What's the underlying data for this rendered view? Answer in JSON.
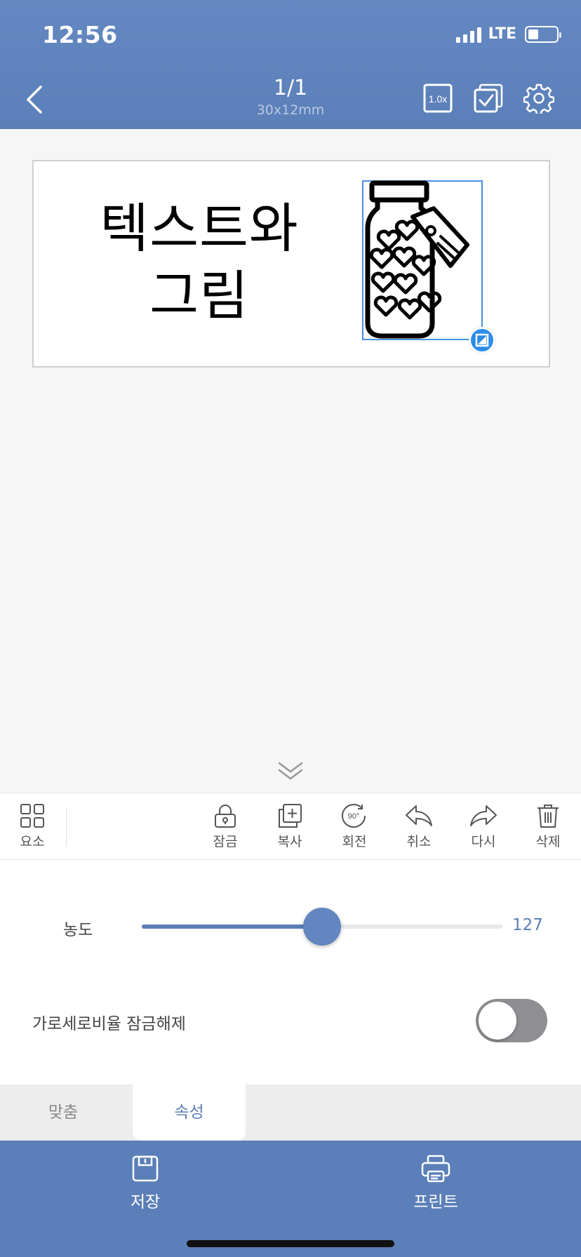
{
  "status_bar": {
    "time": "12:56",
    "network": "LTE",
    "signal_icon": "signal-bars-icon",
    "battery_icon": "battery-low-icon"
  },
  "header": {
    "title": "1/1",
    "subtitle": "30x12mm",
    "zoom_label": "1.0x",
    "icons": [
      "back-chevron-icon",
      "zoom-icon",
      "multi-select-icon",
      "settings-gear-icon"
    ]
  },
  "canvas": {
    "label_text": "텍스트와\n그림",
    "image_icon": "jar-of-hearts-icon"
  },
  "toolbar": {
    "elements_label": "요소",
    "lock_label": "잠금",
    "copy_label": "복사",
    "rotate_label": "회전",
    "rotate_badge": "90°",
    "undo_label": "취소",
    "redo_label": "다시",
    "delete_label": "삭제"
  },
  "properties": {
    "density_label": "농도",
    "density_value": "127",
    "density_fraction": 0.5,
    "ratio_lock_label": "가로세로비율 잠금해제",
    "ratio_lock_on": false
  },
  "tabs": {
    "fit_label": "맞춤",
    "props_label": "속성",
    "active": "속성"
  },
  "bottom": {
    "save_label": "저장",
    "print_label": "프린트"
  },
  "colors": {
    "accent": "#5b7fb8",
    "selection": "#4a90e2",
    "handle": "#2d8ce8"
  }
}
